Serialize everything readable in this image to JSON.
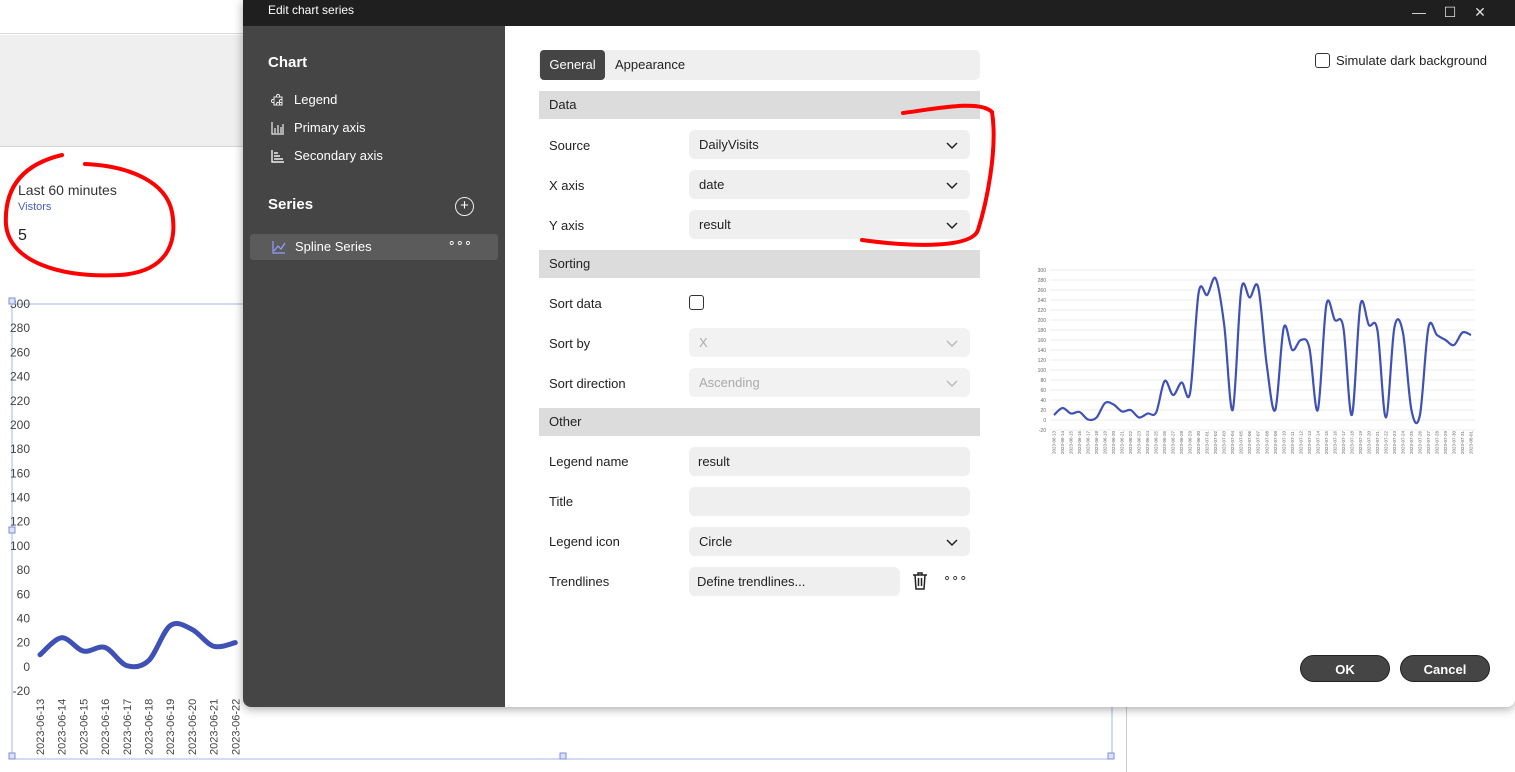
{
  "background": {
    "kpi": {
      "title": "Last 60 minutes",
      "subtitle": "Vistors",
      "value": "5"
    },
    "chart_data": {
      "type": "line",
      "ylim": [
        -20,
        300
      ],
      "yticks": [
        "300",
        "280",
        "260",
        "240",
        "220",
        "200",
        "180",
        "160",
        "140",
        "120",
        "100",
        "80",
        "60",
        "40",
        "20",
        "0",
        "-20"
      ],
      "categories": [
        "2023-06-13",
        "2023-06-14",
        "2023-06-15",
        "2023-06-16",
        "2023-06-17",
        "2023-06-18",
        "2023-06-19",
        "2023-06-20",
        "2023-06-21",
        "2023-06-22"
      ],
      "values": [
        10,
        24,
        13,
        16,
        1,
        5,
        34,
        31,
        17,
        20
      ]
    }
  },
  "dialog": {
    "title": "Edit chart series",
    "window_buttons": {
      "minimize": "—",
      "maximize": "☐",
      "close": "✕"
    },
    "sidebar": {
      "chart_heading": "Chart",
      "chart_items": [
        {
          "label": "Legend",
          "icon": "puzzle-icon"
        },
        {
          "label": "Primary axis",
          "icon": "bar-chart-icon"
        },
        {
          "label": "Secondary axis",
          "icon": "stacked-bars-icon"
        }
      ],
      "series_heading": "Series",
      "series_add": "+",
      "series_items": [
        {
          "label": "Spline Series",
          "icon": "line-chart-icon",
          "more": "∘∘∘"
        }
      ]
    },
    "tabs": [
      "General",
      "Appearance"
    ],
    "sections": {
      "data": "Data",
      "sorting": "Sorting",
      "other": "Other"
    },
    "fields": {
      "source": {
        "label": "Source",
        "value": "DailyVisits"
      },
      "x_axis": {
        "label": "X axis",
        "value": "date"
      },
      "y_axis": {
        "label": "Y axis",
        "value": "result"
      },
      "sort_data": {
        "label": "Sort data",
        "checked": false
      },
      "sort_by": {
        "label": "Sort by",
        "value": "X"
      },
      "sort_direction": {
        "label": "Sort direction",
        "value": "Ascending"
      },
      "legend_name": {
        "label": "Legend name",
        "value": "result"
      },
      "title": {
        "label": "Title",
        "value": ""
      },
      "legend_icon": {
        "label": "Legend icon",
        "value": "Circle"
      },
      "trendlines": {
        "label": "Trendlines",
        "value": "Define trendlines...",
        "more": "∘∘∘"
      }
    },
    "simulate_dark_background": {
      "label": "Simulate dark background",
      "checked": false
    },
    "buttons": {
      "ok": "OK",
      "cancel": "Cancel"
    },
    "colors": {
      "sidebar": "#454545",
      "series_line": "#3f51b5",
      "annotation": "#ff0000"
    }
  },
  "preview_chart": {
    "chart_data": {
      "type": "line",
      "ylim": [
        -20,
        300
      ],
      "yticks": [
        "300",
        "280",
        "260",
        "240",
        "220",
        "200",
        "180",
        "160",
        "140",
        "120",
        "100",
        "80",
        "60",
        "40",
        "20",
        "0",
        "-20"
      ],
      "categories": [
        "2023-06-13",
        "2023-06-14",
        "2023-06-15",
        "2023-06-16",
        "2023-06-17",
        "2023-06-18",
        "2023-06-19",
        "2023-06-20",
        "2023-06-21",
        "2023-06-22",
        "2023-06-23",
        "2023-06-24",
        "2023-06-25",
        "2023-06-26",
        "2023-06-27",
        "2023-06-28",
        "2023-06-29",
        "2023-06-30",
        "2023-07-01",
        "2023-07-02",
        "2023-07-03",
        "2023-07-04",
        "2023-07-05",
        "2023-07-06",
        "2023-07-07",
        "2023-07-08",
        "2023-07-09",
        "2023-07-10",
        "2023-07-11",
        "2023-07-12",
        "2023-07-13",
        "2023-07-14",
        "2023-07-15",
        "2023-07-16",
        "2023-07-17",
        "2023-07-18",
        "2023-07-19",
        "2023-07-20",
        "2023-07-21",
        "2023-07-22",
        "2023-07-23",
        "2023-07-24",
        "2023-07-25",
        "2023-07-26",
        "2023-07-27",
        "2023-07-28",
        "2023-07-29",
        "2023-07-30",
        "2023-07-31",
        "2023-08-01"
      ],
      "values": [
        10,
        24,
        13,
        16,
        1,
        5,
        34,
        31,
        17,
        20,
        5,
        13,
        15,
        78,
        50,
        75,
        55,
        255,
        250,
        283,
        190,
        20,
        260,
        245,
        265,
        110,
        20,
        185,
        140,
        160,
        145,
        20,
        230,
        200,
        185,
        10,
        230,
        190,
        180,
        5,
        185,
        175,
        20,
        10,
        185,
        170,
        160,
        150,
        175,
        170
      ]
    }
  }
}
